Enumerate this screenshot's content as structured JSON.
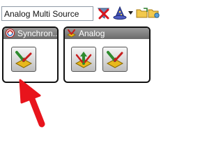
{
  "toolbar": {
    "search_value": "Analog Multi Source",
    "icons": [
      "clear-filter-icon",
      "wizard-hat-icon",
      "chevron-down-icon",
      "folder-open-icon",
      "folder-settings-icon"
    ]
  },
  "tiles": [
    {
      "header_label": "Synchron...",
      "header_icon": "sync-badge-icon",
      "buttons": [
        "sync-source-icon"
      ]
    },
    {
      "header_label": "Analog",
      "header_icon": "analog-folder-icon",
      "buttons": [
        "analog-source-up-icon",
        "analog-source-down-icon"
      ]
    }
  ],
  "colors": {
    "header": "#7a7a7a",
    "pointer_arrow": "#e8141c",
    "border": "#111111"
  }
}
